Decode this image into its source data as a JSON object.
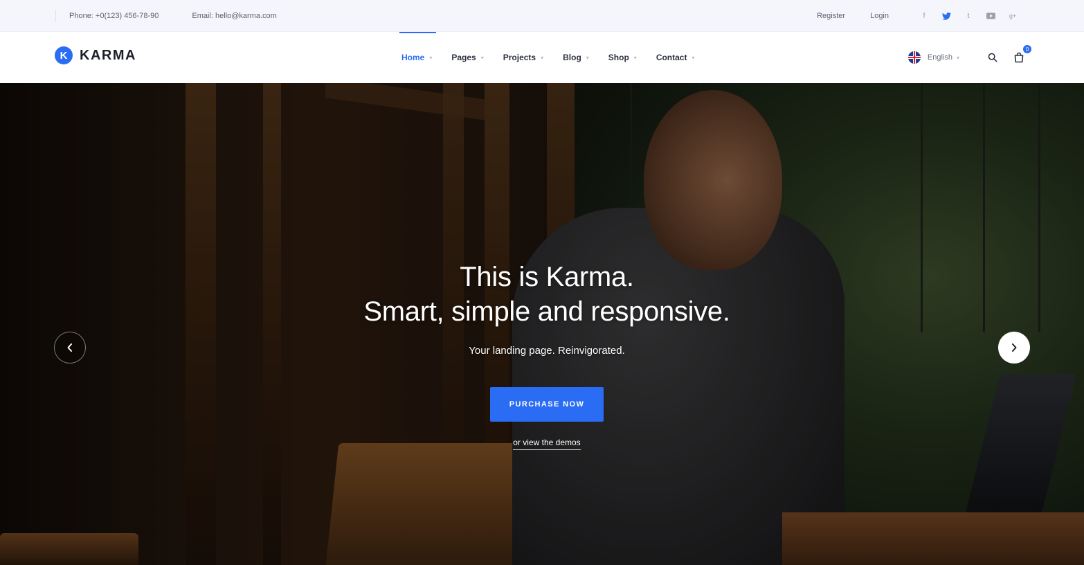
{
  "topbar": {
    "phone": "Phone: +0(123) 456-78-90",
    "email": "Email: hello@karma.com",
    "register": "Register",
    "login": "Login",
    "socials": [
      {
        "icon": "facebook-icon",
        "glyph": "f"
      },
      {
        "icon": "twitter-icon",
        "glyph": "🐦"
      },
      {
        "icon": "tumblr-icon",
        "glyph": "t"
      },
      {
        "icon": "youtube-icon",
        "glyph": "▶"
      },
      {
        "icon": "google-plus-icon",
        "glyph": "g+"
      }
    ]
  },
  "header": {
    "logo_letter": "K",
    "logo_text": "KARMA",
    "nav": [
      {
        "label": "Home",
        "active": true
      },
      {
        "label": "Pages",
        "active": false
      },
      {
        "label": "Projects",
        "active": false
      },
      {
        "label": "Blog",
        "active": false
      },
      {
        "label": "Shop",
        "active": false
      },
      {
        "label": "Contact",
        "active": false
      }
    ],
    "language": "English",
    "cart_count": "0"
  },
  "hero": {
    "title_line1": "This is Karma.",
    "title_line2": "Smart, simple and responsive.",
    "subtitle": "Your landing page. Reinvigorated.",
    "cta_label": "PURCHASE NOW",
    "demo_link": "or view the demos"
  },
  "colors": {
    "accent": "#2a6df4",
    "topbar_bg": "#f4f6fb"
  }
}
